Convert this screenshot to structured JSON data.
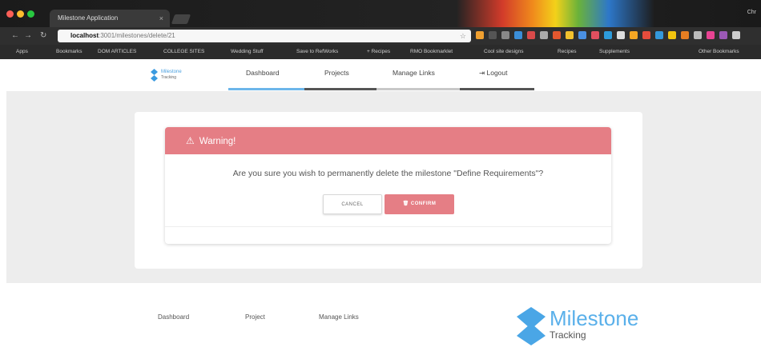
{
  "browser": {
    "tab_title": "Milestone Application",
    "tab_close": "×",
    "user_chip": "Chr",
    "url_host": "localhost",
    "url_path": ":3001/milestones/delete/21",
    "bookmarks": [
      "Apps",
      "Bookmarks",
      "DOM ARTICLES",
      "COLLEGE SITES",
      "Wedding Stuff",
      "Save to RefWorks",
      "+ Recipes",
      "RMO Bookmarklet",
      "Cool site designs",
      "Recipes",
      "Supplements",
      "Other Bookmarks"
    ],
    "colors": {
      "close": "#fc5f57",
      "minimize": "#fdbc2e",
      "maximize": "#28c840"
    }
  },
  "nav": {
    "logo_name": "Milestone",
    "logo_sub": "Tracking",
    "links": [
      "Dashboard",
      "Projects",
      "Manage Links",
      "Logout"
    ],
    "logout_icon": "logout-icon"
  },
  "modal": {
    "title": "Warning!",
    "title_icon": "warning-triangle-icon",
    "message": "Are you sure you wish to permanently delete the milestone \"Define Requirements\"?",
    "cancel_label": "CANCEL",
    "confirm_label": "CONFIRM",
    "confirm_icon": "trash-icon",
    "accent": "#e57e85"
  },
  "footer": {
    "links": [
      "Dashboard",
      "Project",
      "Manage Links"
    ],
    "logo_name": "Milestone",
    "logo_sub": "Tracking"
  }
}
